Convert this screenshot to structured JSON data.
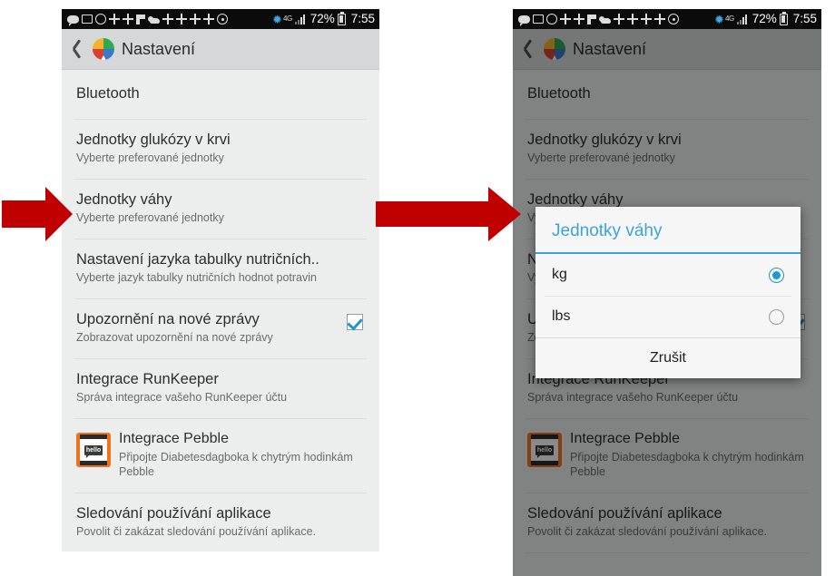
{
  "colors": {
    "accent": "#3ca3d8",
    "radio_selected": "#1b9ad2",
    "checkbox_check": "#2196c4",
    "arrow_red": "#c00000",
    "status_bar_bg": "#0b0b0b",
    "action_bar_bg": "#d6d7d8",
    "list_bg": "#eceded",
    "dialog_bg": "#f6f6f6"
  },
  "status_bar": {
    "icons": [
      "sms-icon",
      "image-icon",
      "person-circle-icon",
      "sync-icon",
      "sync-icon",
      "flag-icon",
      "cloud-upload-icon",
      "sync-icon",
      "sync-icon",
      "sync-icon",
      "sync-icon",
      "target-icon",
      "bluetooth-icon",
      "network-4g-icon",
      "signal-bars-icon"
    ],
    "battery_percent": "72%",
    "battery_icon": "battery-charging-icon",
    "clock": "7:55",
    "network_label": "4G"
  },
  "action_bar": {
    "back_icon": "back-chevron-icon",
    "app_icon": "app-logo-icon",
    "title": "Nastavení"
  },
  "settings_list": [
    {
      "title": "Bluetooth",
      "subtitle": "",
      "icon": "",
      "control": ""
    },
    {
      "title": "Jednotky glukózy v krvi",
      "subtitle": "Vyberte preferované jednotky",
      "icon": "",
      "control": ""
    },
    {
      "title": "Jednotky váhy",
      "subtitle": "Vyberte preferované jednotky",
      "icon": "",
      "control": ""
    },
    {
      "title": "Nastavení jazyka tabulky nutričních..",
      "subtitle": "Vyberte jazyk tabulky nutričních hodnot potravin",
      "icon": "",
      "control": ""
    },
    {
      "title": "Upozornění na nové zprávy",
      "subtitle": "Zobrazovat upozornění na nové zprávy",
      "icon": "",
      "control": "checkbox",
      "checked": true
    },
    {
      "title": "Integrace RunKeeper",
      "subtitle": "Správa integrace vašeho RunKeeper účtu",
      "icon": "",
      "control": ""
    },
    {
      "title": "Integrace Pebble",
      "subtitle": "Připojte Diabetesdagboka k chytrým hodinkám Pebble",
      "icon": "pebble-watch-icon",
      "icon_text": "hello",
      "control": ""
    },
    {
      "title": "Sledování používání aplikace",
      "subtitle": "Povolit či zakázat sledování používání aplikace.",
      "icon": "",
      "control": ""
    }
  ],
  "dialog": {
    "title": "Jednotky váhy",
    "options": [
      {
        "label": "kg",
        "selected": true
      },
      {
        "label": "lbs",
        "selected": false
      }
    ],
    "cancel_label": "Zrušit"
  },
  "annotations": {
    "arrow_left_name": "red-arrow-pointing-to-jednotky-vahy",
    "arrow_middle_name": "red-arrow-step-transition"
  }
}
